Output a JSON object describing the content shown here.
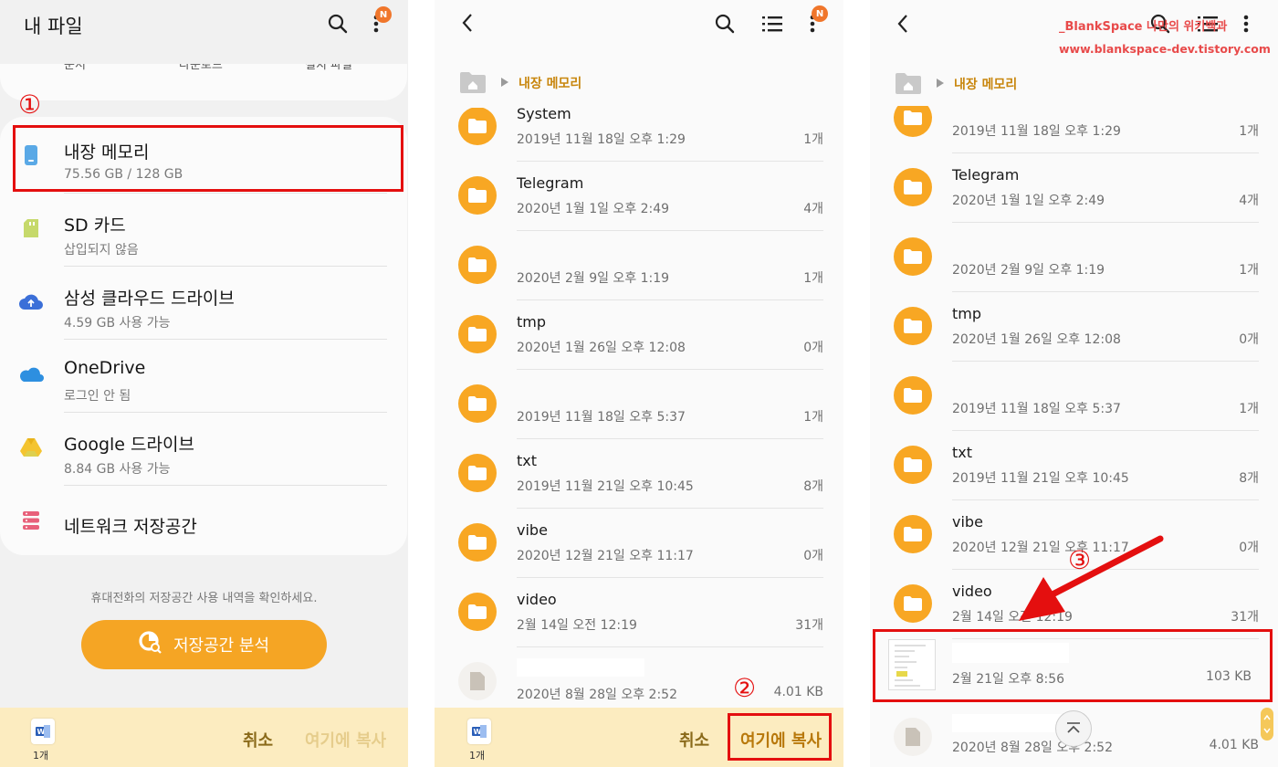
{
  "panel1": {
    "title": "내 파일",
    "badge": "N",
    "top_tabs": [
      "문서",
      "다운로드",
      "설치 파일"
    ],
    "storage": [
      {
        "title": "내장 메모리",
        "sub": "75.56 GB / 128 GB",
        "icon": "phone-icon"
      },
      {
        "title": "SD 카드",
        "sub": "삽입되지 않음",
        "icon": "sd-card-icon"
      },
      {
        "title": "삼성 클라우드 드라이브",
        "sub": "4.59 GB 사용 가능",
        "icon": "samsung-cloud-icon"
      },
      {
        "title": "OneDrive",
        "sub": "로그인 안 됨",
        "icon": "onedrive-icon"
      },
      {
        "title": "Google 드라이브",
        "sub": "8.84 GB 사용 가능",
        "icon": "google-drive-icon"
      },
      {
        "title": "네트워크 저장공간",
        "sub": "",
        "icon": "network-storage-icon"
      }
    ],
    "hint": "휴대전화의 저장공간 사용 내역을 확인하세요.",
    "analyze_label": "저장공간 분석",
    "step": "①",
    "bottom": {
      "count": "1개",
      "cancel": "취소",
      "copy_here": "여기에 복사"
    }
  },
  "panel2": {
    "badge": "N",
    "breadcrumb": "내장 메모리",
    "rows": [
      {
        "name": "System",
        "date": "2019년 11월 18일 오후 1:29",
        "count": "1개"
      },
      {
        "name": "Telegram",
        "date": "2020년 1월 1일 오후 2:49",
        "count": "4개"
      },
      {
        "name": "",
        "date": "2020년 2월 9일 오후 1:19",
        "count": "1개"
      },
      {
        "name": "tmp",
        "date": "2020년 1월 26일 오후 12:08",
        "count": "0개"
      },
      {
        "name": "",
        "date": "2019년 11월 18일 오후 5:37",
        "count": "1개"
      },
      {
        "name": "txt",
        "date": "2019년 11월 21일 오후 10:45",
        "count": "8개"
      },
      {
        "name": "vibe",
        "date": "2020년 12월 21일 오후 11:17",
        "count": "0개"
      },
      {
        "name": "video",
        "date": "2월 14일 오전 12:19",
        "count": "31개"
      },
      {
        "name": "",
        "date": "2020년 8월 28일 오후 2:52",
        "count": "4.01 KB"
      }
    ],
    "step": "②",
    "bottom": {
      "count": "1개",
      "cancel": "취소",
      "copy_here": "여기에 복사"
    }
  },
  "panel3": {
    "breadcrumb": "내장 메모리",
    "watermark_line1": "_BlankSpace 나만의 위키백과",
    "watermark_line2": "www.blankspace-dev.tistory.com",
    "rows": [
      {
        "name": "",
        "date": "2019년 11월 18일 오후 1:29",
        "count": "1개"
      },
      {
        "name": "Telegram",
        "date": "2020년 1월 1일 오후 2:49",
        "count": "4개"
      },
      {
        "name": "",
        "date": "2020년 2월 9일 오후 1:19",
        "count": "1개"
      },
      {
        "name": "tmp",
        "date": "2020년 1월 26일 오후 12:08",
        "count": "0개"
      },
      {
        "name": "",
        "date": "2019년 11월 18일 오후 5:37",
        "count": "1개"
      },
      {
        "name": "txt",
        "date": "2019년 11월 21일 오후 10:45",
        "count": "8개"
      },
      {
        "name": "vibe",
        "date": "2020년 12월 21일 오후 11:17",
        "count": "0개"
      },
      {
        "name": "video",
        "date": "2월 14일 오전 12:19",
        "count": "31개"
      }
    ],
    "copied_file": {
      "date": "2월 21일 오후 8:56",
      "size": "103 KB"
    },
    "last_file": {
      "date": "2020년 8월 28일 오후 2:52",
      "size": "4.01 KB"
    },
    "step": "③"
  },
  "colors": {
    "accent": "#f5a524",
    "folder": "#f8a723",
    "highlight": "#e40f0f",
    "bottom_bar": "#fcecc0",
    "breadcrumb": "#c8860d"
  }
}
